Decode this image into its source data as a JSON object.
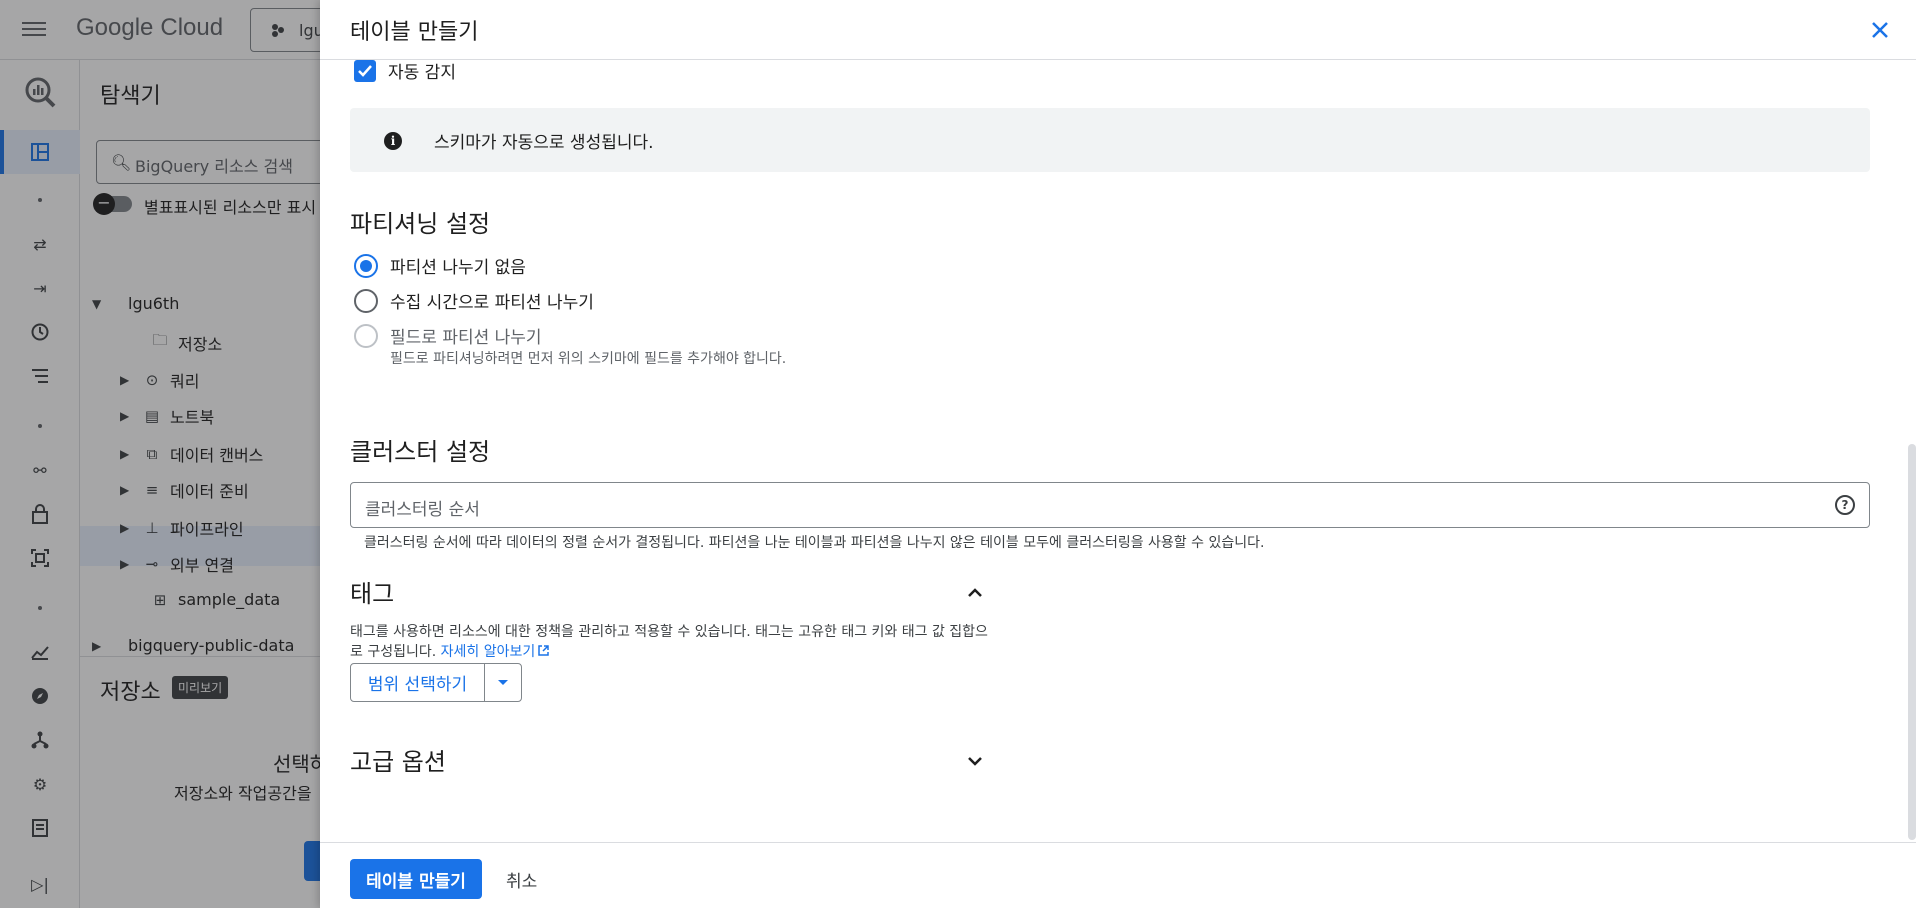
{
  "app": {
    "logo_text": "Google",
    "logo_suffix": "Cloud",
    "project_name": "lgu"
  },
  "explorer": {
    "title": "탐색기",
    "search_placeholder": "BigQuery 리소스 검색",
    "toggle_label": "별표표시된 리소스만 표시",
    "project": "lgu6th",
    "items": [
      {
        "label": "저장소"
      },
      {
        "label": "쿼리"
      },
      {
        "label": "노트북"
      },
      {
        "label": "데이터 캔버스"
      },
      {
        "label": "데이터 준비"
      },
      {
        "label": "파이프라인"
      },
      {
        "label": "외부 연결"
      },
      {
        "label": "sample_data"
      }
    ],
    "public_project": "bigquery-public-data",
    "storage_title": "저장소",
    "preview_badge": "미리보기",
    "storage_select": "선택하",
    "storage_desc": "저장소와 작업공간을"
  },
  "panel": {
    "title": "테이블 만들기",
    "auto_detect_label": "자동 감지",
    "auto_detect_checked": true,
    "info_text": "스키마가 자동으로 생성됩니다.",
    "partition": {
      "title": "파티셔닝 설정",
      "options": [
        {
          "label": "파티션 나누기 없음",
          "selected": true
        },
        {
          "label": "수집 시간으로 파티션 나누기",
          "selected": false
        },
        {
          "label": "필드로 파티션 나누기",
          "selected": false,
          "disabled": true
        }
      ],
      "field_hint": "필드로 파티셔닝하려면 먼저 위의 스키마에 필드를 추가해야 합니다."
    },
    "cluster": {
      "title": "클러스터 설정",
      "placeholder": "클러스터링 순서",
      "hint": "클러스터링 순서에 따라 데이터의 정렬 순서가 결정됩니다. 파티션을 나눈 테이블과 파티션을 나누지 않은 테이블 모두에 클러스터링을 사용할 수 있습니다."
    },
    "tags": {
      "title": "태그",
      "desc": "태그를 사용하면 리소스에 대한 정책을 관리하고 적용할 수 있습니다. 태그는 고유한 태그 키와 태그 값 집합으로 구성됩니다.",
      "learn_more": "자세히 알아보기",
      "scope_button": "범위 선택하기"
    },
    "advanced": {
      "title": "고급 옵션"
    },
    "footer": {
      "create_button": "테이블 만들기",
      "cancel_button": "취소"
    }
  },
  "colors": {
    "accent": "#1a73e8",
    "info_bg": "#f1f3f4",
    "overlay": "rgba(32,33,36,0.4)"
  },
  "icons": {
    "menu": "hamburger-icon",
    "close": "close-icon",
    "info": "info-icon",
    "help": "help-icon",
    "tags_toggle": "chevron-up-icon",
    "advanced_toggle": "chevron-down-icon",
    "external_link": "external-link-icon"
  }
}
